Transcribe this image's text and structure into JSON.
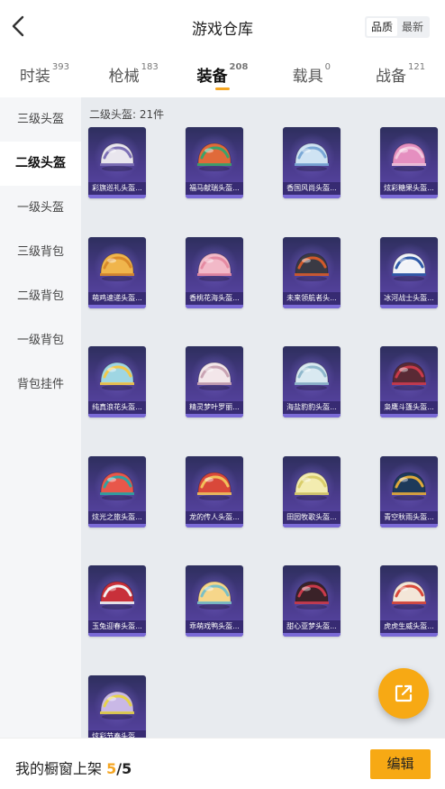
{
  "header": {
    "title": "游戏仓库",
    "back_icon": "chevron-left-icon",
    "sort_options": [
      "品质",
      "最新"
    ],
    "sort_selected": "品质"
  },
  "tabs": [
    {
      "label": "时装",
      "count": "393"
    },
    {
      "label": "枪械",
      "count": "183"
    },
    {
      "label": "装备",
      "count": "208",
      "active": true
    },
    {
      "label": "载具",
      "count": "0"
    },
    {
      "label": "战备",
      "count": "121"
    }
  ],
  "sidebar": {
    "items": [
      "三级头盔",
      "二级头盔",
      "一级头盔",
      "三级背包",
      "二级背包",
      "一级背包",
      "背包挂件"
    ],
    "active": "二级头盔"
  },
  "main": {
    "section_title": "二级头盔: 21件",
    "items": [
      {
        "name": "彩旗巡礼头盔...",
        "colors": [
          "#e9e6ee",
          "#7c6fb5"
        ]
      },
      {
        "name": "福马献瑞头盔...",
        "colors": [
          "#e06a3a",
          "#3aa36a"
        ]
      },
      {
        "name": "香国风尚头盔...",
        "colors": [
          "#cfe3f3",
          "#7aa8d6"
        ]
      },
      {
        "name": "炫彩糖果头盔...",
        "colors": [
          "#e58fc0",
          "#f3c7de"
        ]
      },
      {
        "name": "萌鸡速递头盔...",
        "colors": [
          "#f0b54c",
          "#d98a2b"
        ]
      },
      {
        "name": "香桃花海头盔...",
        "colors": [
          "#f2b9c8",
          "#e58aa2"
        ]
      },
      {
        "name": "未来领航者头...",
        "colors": [
          "#3a3a44",
          "#d35a2a"
        ]
      },
      {
        "name": "冰河战士头盔...",
        "colors": [
          "#f2f4f8",
          "#2f5aa8"
        ]
      },
      {
        "name": "纯真浪花头盔...",
        "colors": [
          "#9fd6e3",
          "#f2c84a"
        ]
      },
      {
        "name": "精灵梦叶罗丽...",
        "colors": [
          "#f3e6ea",
          "#c9a3b3"
        ]
      },
      {
        "name": "海盐豹豹头盔...",
        "colors": [
          "#d9e9f1",
          "#8fb8cc"
        ]
      },
      {
        "name": "枭鹰斗篷头盔...",
        "colors": [
          "#5a2a35",
          "#c93a4a"
        ]
      },
      {
        "name": "炫光之旅头盔...",
        "colors": [
          "#e8574a",
          "#2fa3a1"
        ]
      },
      {
        "name": "龙的传人头盔...",
        "colors": [
          "#d9483a",
          "#f2c05a"
        ]
      },
      {
        "name": "田园牧歌头盔...",
        "colors": [
          "#f3ecb0",
          "#d9cd6a"
        ]
      },
      {
        "name": "青空秋雨头盔...",
        "colors": [
          "#1d3a5a",
          "#e0a93a"
        ]
      },
      {
        "name": "玉兔迎春头盔...",
        "colors": [
          "#c8303a",
          "#f2f2f2"
        ]
      },
      {
        "name": "乖萌戏鸭头盔...",
        "colors": [
          "#f6d68a",
          "#7ac0c6"
        ]
      },
      {
        "name": "甜心亚梦头盔...",
        "colors": [
          "#3a2228",
          "#c93a4a"
        ]
      },
      {
        "name": "虎虎生威头盔...",
        "colors": [
          "#f3e6d8",
          "#d9483a"
        ]
      },
      {
        "name": "炫彩节奏头盔...",
        "colors": [
          "#c9b8e6",
          "#e6d24a"
        ]
      }
    ]
  },
  "fab": {
    "icon": "share-external-icon"
  },
  "footer": {
    "label": "我的橱窗上架",
    "count": "5",
    "separator": "/",
    "total": "5",
    "edit_label": "编辑"
  }
}
